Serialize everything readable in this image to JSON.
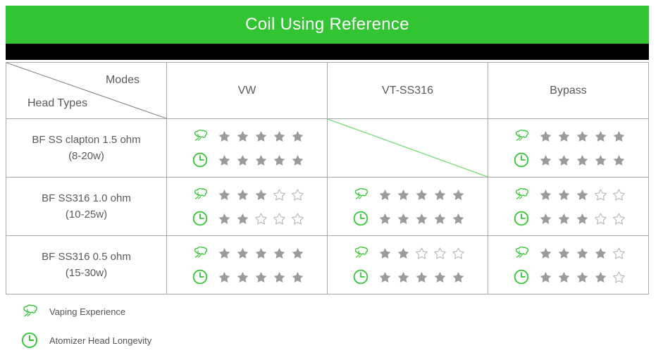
{
  "title": "Coil Using Reference",
  "table": {
    "corner": {
      "columns_label": "Modes",
      "rows_label": "Head Types"
    },
    "mode_columns": [
      "VW",
      "VT-SS316",
      "Bypass"
    ],
    "rows": [
      {
        "head_type_line1": "BF SS clapton 1.5 ohm",
        "head_type_line2": "(8-20w)",
        "cells": [
          {
            "mode": "VW",
            "available": true,
            "vaping_experience": 5,
            "atomizer_head_longevity": 5
          },
          {
            "mode": "VT-SS316",
            "available": false,
            "vaping_experience": 0,
            "atomizer_head_longevity": 0
          },
          {
            "mode": "Bypass",
            "available": true,
            "vaping_experience": 5,
            "atomizer_head_longevity": 5
          }
        ]
      },
      {
        "head_type_line1": "BF SS316 1.0 ohm",
        "head_type_line2": "(10-25w)",
        "cells": [
          {
            "mode": "VW",
            "available": true,
            "vaping_experience": 3,
            "atomizer_head_longevity": 2
          },
          {
            "mode": "VT-SS316",
            "available": true,
            "vaping_experience": 5,
            "atomizer_head_longevity": 5
          },
          {
            "mode": "Bypass",
            "available": true,
            "vaping_experience": 3,
            "atomizer_head_longevity": 3
          }
        ]
      },
      {
        "head_type_line1": "BF SS316 0.5 ohm",
        "head_type_line2": "(15-30w)",
        "cells": [
          {
            "mode": "VW",
            "available": true,
            "vaping_experience": 5,
            "atomizer_head_longevity": 5
          },
          {
            "mode": "VT-SS316",
            "available": true,
            "vaping_experience": 2,
            "atomizer_head_longevity": 5
          },
          {
            "mode": "Bypass",
            "available": true,
            "vaping_experience": 4,
            "atomizer_head_longevity": 4
          }
        ]
      }
    ],
    "max_stars": 5
  },
  "legend": [
    {
      "icon": "vapor-cloud-icon",
      "label": "Vaping Experience"
    },
    {
      "icon": "clock-icon",
      "label": "Atomizer Head Longevity"
    }
  ],
  "colors": {
    "brand_green": "#33c433",
    "header_black": "#000000",
    "star_filled": "#9b9b9b",
    "star_empty_outline": "#b5b5b5",
    "grid_line": "#a8a8a8",
    "strike_green": "#7ede7e",
    "text": "#5a5a5a"
  }
}
